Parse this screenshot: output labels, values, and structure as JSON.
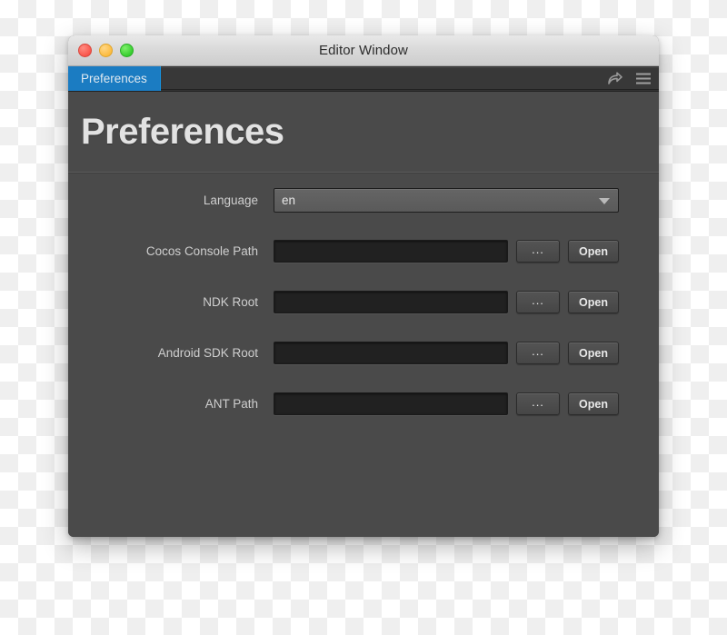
{
  "window": {
    "title": "Editor Window",
    "traffic_lights": [
      {
        "name": "close",
        "color": "#f9564c"
      },
      {
        "name": "minimize",
        "color": "#fcbc40"
      },
      {
        "name": "maximize",
        "color": "#37ce2f"
      }
    ]
  },
  "tabbar": {
    "active_tab": "Preferences",
    "accent_color": "#1b7cc2",
    "icons": [
      {
        "name": "share-arrow-icon"
      },
      {
        "name": "hamburger-menu-icon"
      }
    ]
  },
  "page": {
    "title": "Preferences"
  },
  "form": {
    "language": {
      "label": "Language",
      "value": "en",
      "options": [
        "en"
      ]
    },
    "paths": [
      {
        "label": "Cocos Console Path",
        "value": "",
        "placeholder": "",
        "browse_label": "...",
        "open_label": "Open"
      },
      {
        "label": "NDK Root",
        "value": "",
        "placeholder": "",
        "browse_label": "...",
        "open_label": "Open"
      },
      {
        "label": "Android SDK Root",
        "value": "",
        "placeholder": "",
        "browse_label": "...",
        "open_label": "Open"
      },
      {
        "label": "ANT Path",
        "value": "",
        "placeholder": "",
        "browse_label": "...",
        "open_label": "Open"
      }
    ]
  },
  "colors": {
    "panel_bg": "#4a4a4a",
    "tabbar_bg": "#333333",
    "input_bg": "#212121",
    "accent": "#1b7cc2"
  }
}
